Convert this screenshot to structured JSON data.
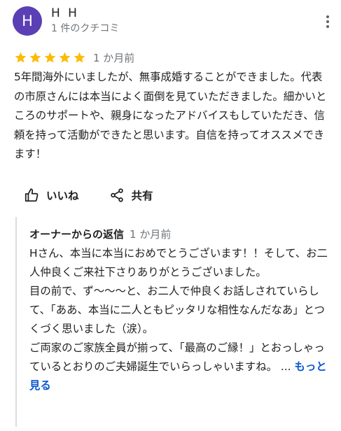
{
  "reviewer": {
    "avatar_letter": "H",
    "avatar_color": "#5a3fb5",
    "name": "H H",
    "review_count": "1 件のクチコミ"
  },
  "more_icon": "more-vert-icon",
  "rating": {
    "stars": 5,
    "max_stars": 5,
    "star_color": "#fbbc04",
    "time": "1 か月前"
  },
  "review": {
    "text": "5年間海外にいましたが、無事成婚することができました。代表の市原さんには本当によく面倒を見ていただきました。細かいところのサポートや、親身になったアドバイスもしていただき、信頼を持って活動ができたと思います。自信を持ってオススメできます！"
  },
  "actions": {
    "like_label": "いいね",
    "like_icon": "thumb-up-icon",
    "share_label": "共有",
    "share_icon": "share-icon"
  },
  "owner_reply": {
    "label": "オーナーからの返信",
    "time": "1 か月前",
    "text": "Hさん、本当に本当におめでとうございます！！そして、お二人仲良くご来社下さりありがとうございました。\n目の前で、ず〜〜〜と、お二人で仲良くお話しされていらして、「ああ、本当に二人ともピッタリな相性なんだなあ」とつくづく思いました（涙）。\nご両家のご家族全員が揃って、「最高のご縁！」とおっしゃっているとおりのご夫婦誕生でいらっしゃいますね。 ...",
    "see_more": "もっと見る",
    "accent_color": "#0b57d0"
  }
}
